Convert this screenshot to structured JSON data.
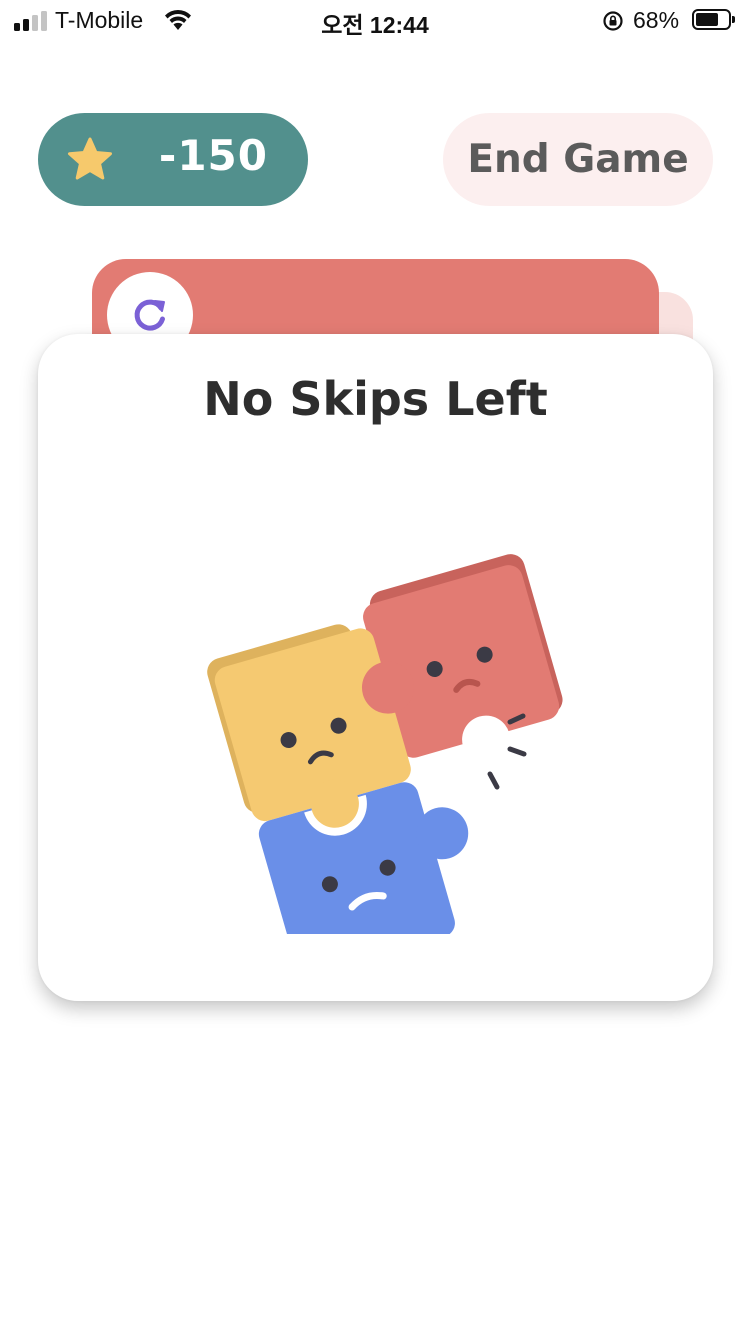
{
  "status_bar": {
    "carrier": "T-Mobile",
    "time": "오전 12:44",
    "battery_percent": "68%",
    "signal_bars_active": 2,
    "signal_bars_total": 4,
    "battery_level": 0.68
  },
  "header": {
    "score": "-150",
    "score_icon": "star-icon",
    "end_game_label": "End Game"
  },
  "card_stack": {
    "refresh_icon": "refresh-icon"
  },
  "dialog": {
    "title": "No Skips Left",
    "illustration": "sad-puzzle-pieces"
  },
  "colors": {
    "score_pill": "#52908d",
    "end_game_bg": "#fcefef",
    "card_red": "#e27b73",
    "puzzle_yellow": "#f5c971",
    "puzzle_red": "#e27b73",
    "puzzle_blue": "#6a8fe8",
    "star": "#f6c96c",
    "refresh": "#7b61d6"
  }
}
